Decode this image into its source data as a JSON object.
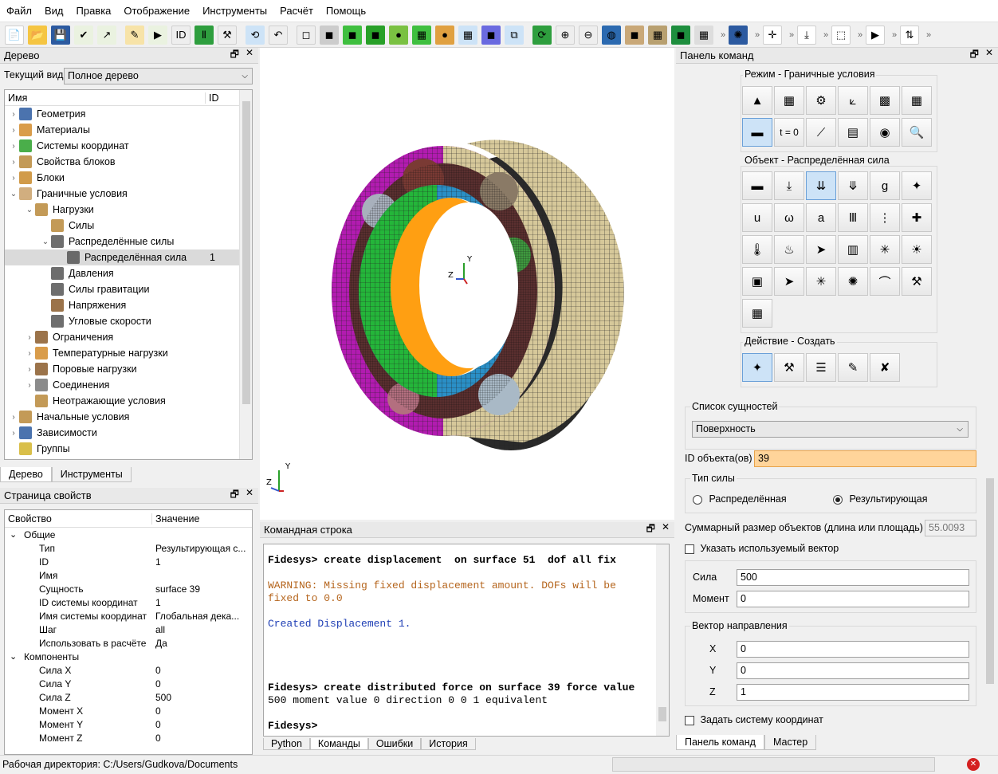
{
  "menu": [
    "Файл",
    "Вид",
    "Правка",
    "Отображение",
    "Инструменты",
    "Расчёт",
    "Помощь"
  ],
  "toolbar_overflow": "»",
  "tree_panel": {
    "title": "Дерево",
    "view_label": "Текущий вид",
    "view_value": "Полное дерево",
    "col_name": "Имя",
    "col_id": "ID",
    "items": [
      {
        "label": "Геометрия",
        "id": ""
      },
      {
        "label": "Материалы",
        "id": ""
      },
      {
        "label": "Системы координат",
        "id": ""
      },
      {
        "label": "Свойства блоков",
        "id": ""
      },
      {
        "label": "Блоки",
        "id": ""
      },
      {
        "label": "Граничные условия",
        "id": ""
      },
      {
        "label": "Нагрузки",
        "id": ""
      },
      {
        "label": "Силы",
        "id": ""
      },
      {
        "label": "Распределённые силы",
        "id": ""
      },
      {
        "label": "Распределённая сила",
        "id": "1"
      },
      {
        "label": "Давления",
        "id": ""
      },
      {
        "label": "Силы гравитации",
        "id": ""
      },
      {
        "label": "Напряжения",
        "id": ""
      },
      {
        "label": "Угловые скорости",
        "id": ""
      },
      {
        "label": "Ограничения",
        "id": ""
      },
      {
        "label": "Температурные нагрузки",
        "id": ""
      },
      {
        "label": "Поровые нагрузки",
        "id": ""
      },
      {
        "label": "Соединения",
        "id": ""
      },
      {
        "label": "Неотражающие условия",
        "id": ""
      },
      {
        "label": "Начальные условия",
        "id": ""
      },
      {
        "label": "Зависимости",
        "id": ""
      },
      {
        "label": "Группы",
        "id": ""
      }
    ],
    "tabs": [
      "Дерево",
      "Инструменты"
    ]
  },
  "props_panel": {
    "title": "Страница свойств",
    "col_prop": "Свойство",
    "col_val": "Значение",
    "group_general": "Общие",
    "rows_general": [
      {
        "k": "Тип",
        "v": "Результирующая с..."
      },
      {
        "k": "ID",
        "v": "1"
      },
      {
        "k": "Имя",
        "v": ""
      },
      {
        "k": "Сущность",
        "v": "surface 39"
      },
      {
        "k": "ID системы координат",
        "v": "1"
      },
      {
        "k": "Имя системы координат",
        "v": "Глобальная дека..."
      },
      {
        "k": "Шаг",
        "v": "all"
      },
      {
        "k": "Использовать в расчёте",
        "v": "Да"
      }
    ],
    "group_components": "Компоненты",
    "rows_components": [
      {
        "k": "Сила X",
        "v": "0"
      },
      {
        "k": "Сила Y",
        "v": "0"
      },
      {
        "k": "Сила Z",
        "v": "500"
      },
      {
        "k": "Момент X",
        "v": "0"
      },
      {
        "k": "Момент Y",
        "v": "0"
      },
      {
        "k": "Момент Z",
        "v": "0"
      }
    ]
  },
  "viewport": {
    "axis_y": "Y",
    "axis_z": "Z"
  },
  "console": {
    "title": "Командная строка",
    "lines": [
      {
        "text": "Fidesys> create displacement  on surface 51  dof all fix",
        "color": "#000000",
        "bold": true
      },
      {
        "text": "",
        "color": "#000000",
        "bold": false
      },
      {
        "text": "WARNING: Missing fixed displacement amount. DOFs will be",
        "color": "#b5651d",
        "bold": false
      },
      {
        "text": "fixed to 0.0",
        "color": "#b5651d",
        "bold": false
      },
      {
        "text": "",
        "color": "#000000",
        "bold": false
      },
      {
        "text": "Created Displacement 1.",
        "color": "#1f3fb5",
        "bold": false
      },
      {
        "text": "",
        "color": "#000000",
        "bold": false
      },
      {
        "text": "",
        "color": "#000000",
        "bold": false
      },
      {
        "text": "",
        "color": "#000000",
        "bold": false
      },
      {
        "text": "",
        "color": "#000000",
        "bold": false
      },
      {
        "text": "Fidesys> create distributed force on surface 39 force value",
        "color": "#000000",
        "bold": true
      },
      {
        "text": "500 moment value 0 direction 0 0 1 equivalent",
        "color": "#000000",
        "bold": false
      },
      {
        "text": "",
        "color": "#000000",
        "bold": false
      },
      {
        "text": "Fidesys>",
        "color": "#000000",
        "bold": true
      }
    ],
    "tabs": [
      "Python",
      "Команды",
      "Ошибки",
      "История"
    ]
  },
  "command_panel": {
    "title": "Панель команд",
    "mode_label": "Режим - Граничные условия",
    "mode_t0": "t = 0",
    "object_label": "Объект - Распределённая сила",
    "action_label": "Действие - Создать",
    "entity_list_label": "Список сущностей",
    "entity_value": "Поверхность",
    "object_ids_label": "ID объекта(ов)",
    "object_ids_value": "39",
    "force_type_label": "Тип силы",
    "radio_distributed": "Распределённая",
    "radio_resultant": "Результирующая",
    "total_size_label": "Суммарный размер объектов (длина или площадь)",
    "total_size_value": "55.0093",
    "use_vector_label": "Указать используемый вектор",
    "force_label": "Сила",
    "force_value": "500",
    "moment_label": "Момент",
    "moment_value": "0",
    "dir_label": "Вектор направления",
    "x_label": "X",
    "x_value": "0",
    "y_label": "Y",
    "y_value": "0",
    "z_label": "Z",
    "z_value": "1",
    "coord_sys_label": "Задать систему координат",
    "tabs": [
      "Панель команд",
      "Мастер"
    ]
  },
  "statusbar": {
    "workdir": "Рабочая директория: C:/Users/Gudkova/Documents"
  },
  "colors": {
    "accent": "#6aa0d8",
    "selected_input": "#ffd49a",
    "warning": "#b5651d",
    "info": "#1f3fb5"
  }
}
